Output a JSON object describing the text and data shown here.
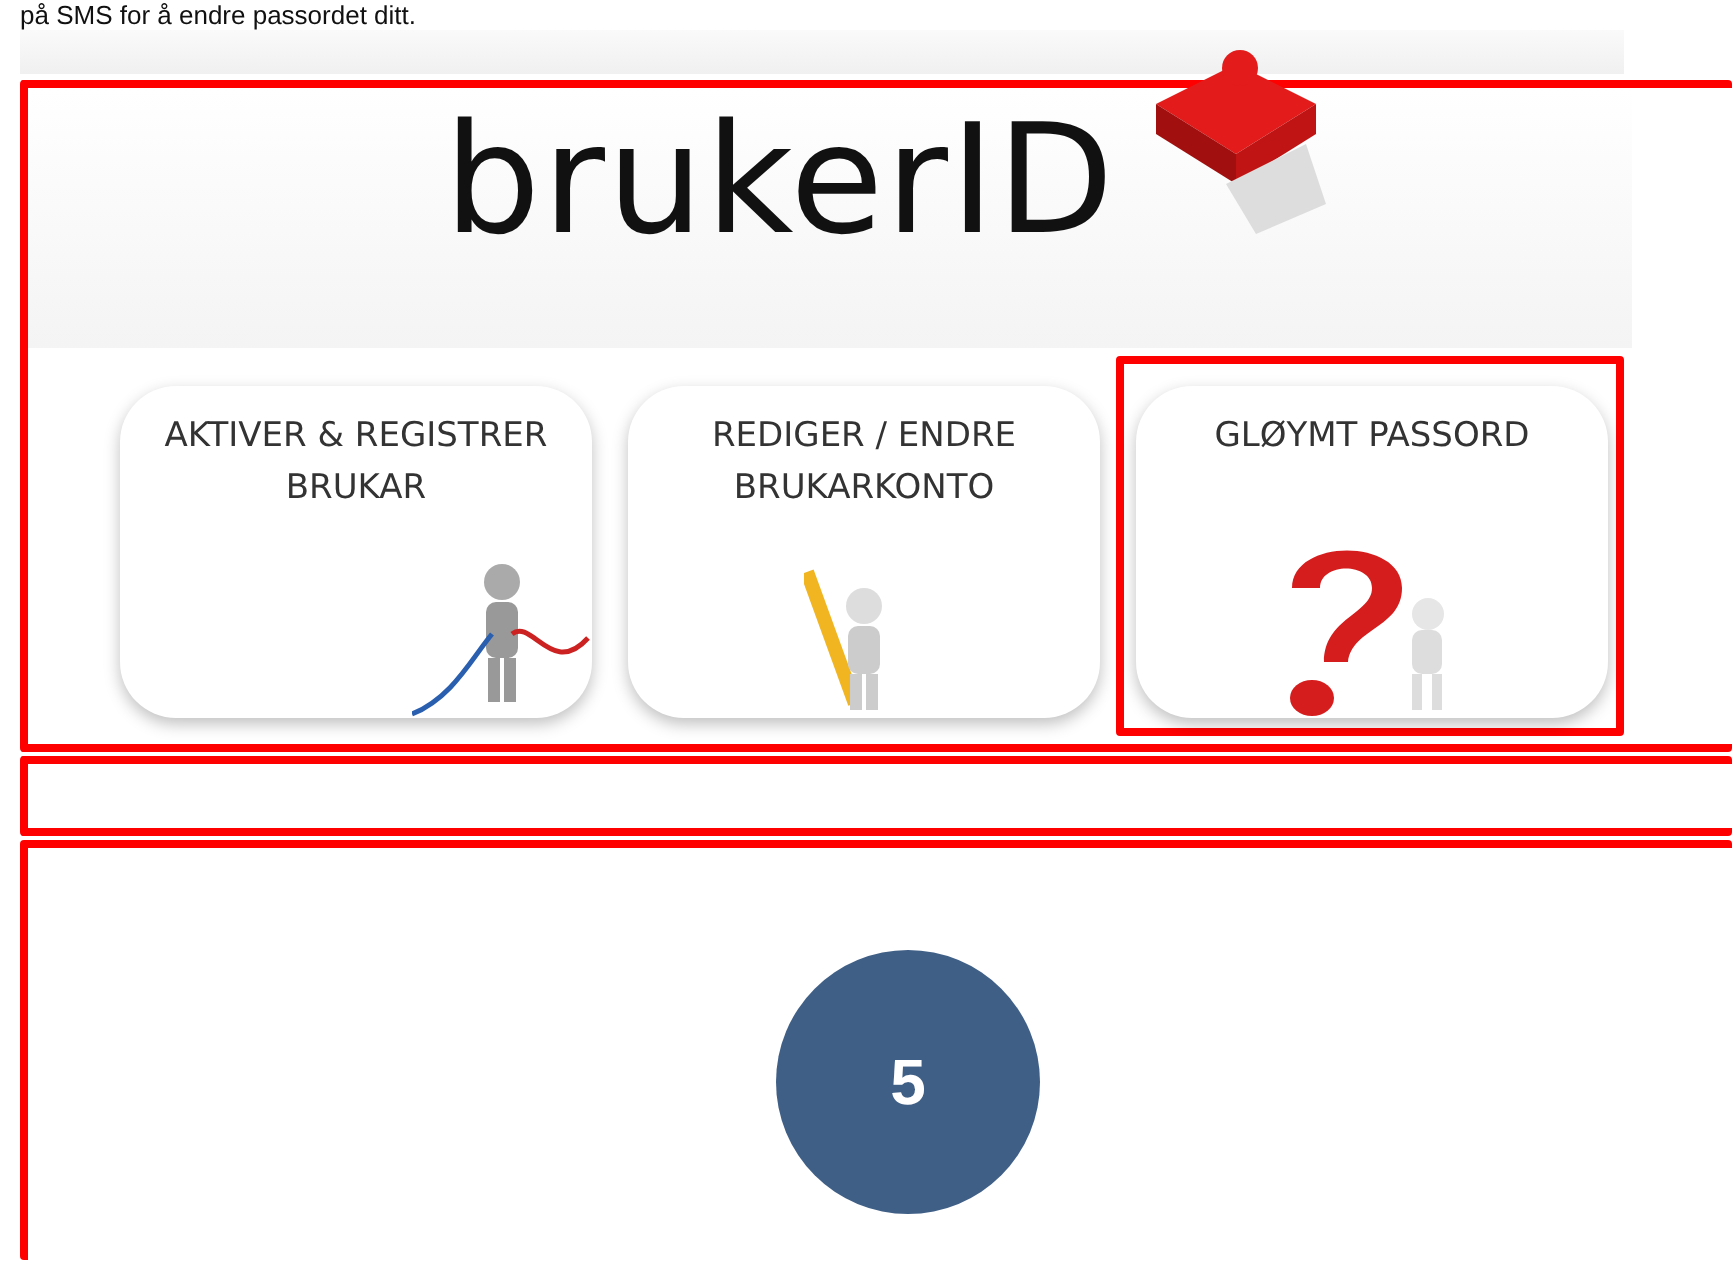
{
  "intro_text": "på SMS for å endre passordet ditt.",
  "logo": {
    "text": "brukerID"
  },
  "tiles": [
    {
      "label": "AKTIVER & REGISTRER BRUKAR",
      "kind": "cable",
      "selected": false
    },
    {
      "label": "REDIGER / ENDRE BRUKARKONTO",
      "kind": "pencil",
      "selected": false
    },
    {
      "label": "GLØYMT PASSORD",
      "kind": "question",
      "selected": true
    }
  ],
  "step_badge": "5"
}
